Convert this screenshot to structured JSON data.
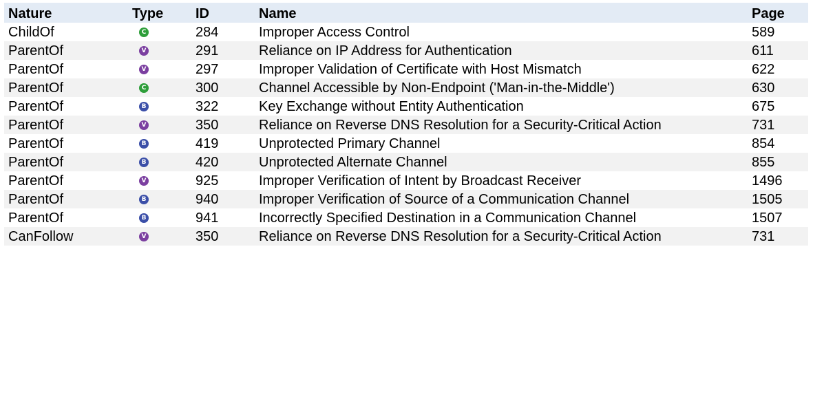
{
  "colors": {
    "header_bg": "#e3ebf5",
    "alt_row_bg": "#f2f2f2",
    "type_C": "#2e9e3a",
    "type_V": "#7b3fa0",
    "type_B": "#3b4fa8"
  },
  "table": {
    "headers": {
      "nature": "Nature",
      "type": "Type",
      "id": "ID",
      "name": "Name",
      "page": "Page"
    },
    "rows": [
      {
        "nature": "ChildOf",
        "type": "C",
        "type_icon": "category-icon",
        "id": "284",
        "name": "Improper Access Control",
        "page": "589"
      },
      {
        "nature": "ParentOf",
        "type": "V",
        "type_icon": "variant-icon",
        "id": "291",
        "name": "Reliance on IP Address for Authentication",
        "page": "611"
      },
      {
        "nature": "ParentOf",
        "type": "V",
        "type_icon": "variant-icon",
        "id": "297",
        "name": "Improper Validation of Certificate with Host Mismatch",
        "page": "622"
      },
      {
        "nature": "ParentOf",
        "type": "C",
        "type_icon": "category-icon",
        "id": "300",
        "name": "Channel Accessible by Non-Endpoint ('Man-in-the-Middle')",
        "page": "630"
      },
      {
        "nature": "ParentOf",
        "type": "B",
        "type_icon": "base-icon",
        "id": "322",
        "name": "Key Exchange without Entity Authentication",
        "page": "675"
      },
      {
        "nature": "ParentOf",
        "type": "V",
        "type_icon": "variant-icon",
        "id": "350",
        "name": "Reliance on Reverse DNS Resolution for a Security-Critical Action",
        "page": "731"
      },
      {
        "nature": "ParentOf",
        "type": "B",
        "type_icon": "base-icon",
        "id": "419",
        "name": "Unprotected Primary Channel",
        "page": "854"
      },
      {
        "nature": "ParentOf",
        "type": "B",
        "type_icon": "base-icon",
        "id": "420",
        "name": "Unprotected Alternate Channel",
        "page": "855"
      },
      {
        "nature": "ParentOf",
        "type": "V",
        "type_icon": "variant-icon",
        "id": "925",
        "name": "Improper Verification of Intent by Broadcast Receiver",
        "page": "1496"
      },
      {
        "nature": "ParentOf",
        "type": "B",
        "type_icon": "base-icon",
        "id": "940",
        "name": "Improper Verification of Source of a Communication Channel",
        "page": "1505"
      },
      {
        "nature": "ParentOf",
        "type": "B",
        "type_icon": "base-icon",
        "id": "941",
        "name": "Incorrectly Specified Destination in a Communication Channel",
        "page": "1507"
      },
      {
        "nature": "CanFollow",
        "type": "V",
        "type_icon": "variant-icon",
        "id": "350",
        "name": "Reliance on Reverse DNS Resolution for a Security-Critical Action",
        "page": "731"
      }
    ]
  }
}
